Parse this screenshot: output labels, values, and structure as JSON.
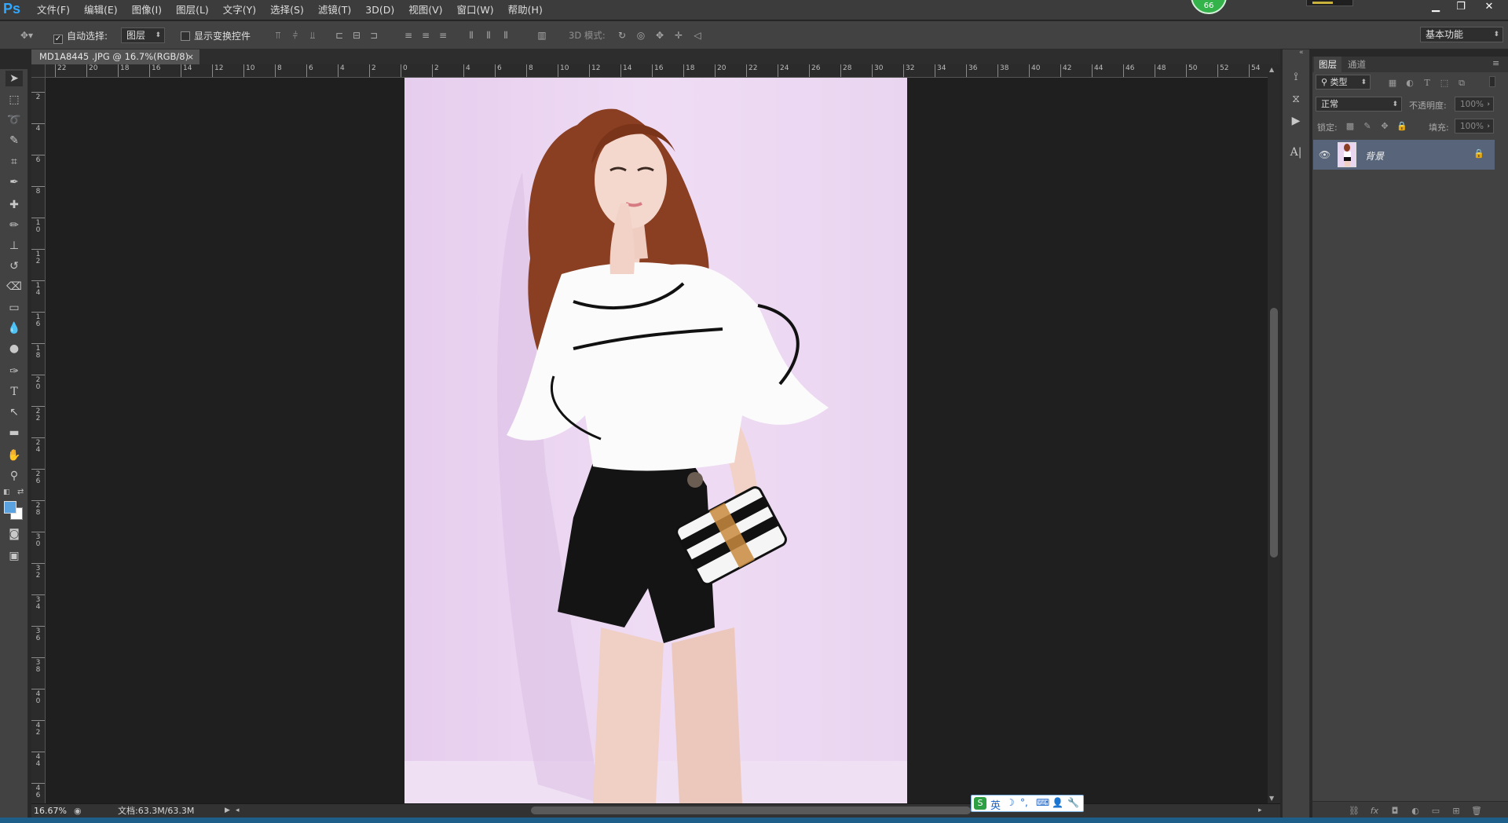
{
  "app": {
    "logo": "Ps",
    "notification_count": "66"
  },
  "menu": [
    "文件(F)",
    "编辑(E)",
    "图像(I)",
    "图层(L)",
    "文字(Y)",
    "选择(S)",
    "滤镜(T)",
    "3D(D)",
    "视图(V)",
    "窗口(W)",
    "帮助(H)"
  ],
  "window_controls": {
    "minimize": "▁",
    "restore": "❐",
    "close": "✕"
  },
  "options": {
    "auto_select_label": "自动选择:",
    "auto_select_checked": true,
    "auto_select_target": "图层",
    "show_transform_label": "显示变换控件",
    "show_transform_checked": false,
    "mode_3d_label": "3D 模式:",
    "workspace": "基本功能"
  },
  "document": {
    "tab_title": "MD1A8445 .JPG @ 16.7%(RGB/8)",
    "zoom": "16.67%",
    "doc_size": "文档:63.3M/63.3M"
  },
  "rulers": {
    "horizontal": [
      "22",
      "20",
      "18",
      "16",
      "14",
      "12",
      "10",
      "8",
      "6",
      "4",
      "2",
      "0",
      "2",
      "4",
      "6",
      "8",
      "10",
      "12",
      "14",
      "16",
      "18",
      "20",
      "22",
      "24",
      "26",
      "28",
      "30",
      "32",
      "34",
      "36",
      "38",
      "40",
      "42",
      "44",
      "46",
      "48",
      "50",
      "52",
      "54"
    ],
    "vertical": [
      "2",
      "4",
      "6",
      "8",
      "10",
      "12",
      "14",
      "16",
      "18",
      "20",
      "22",
      "24",
      "26",
      "28",
      "30",
      "32",
      "34",
      "36",
      "38",
      "40",
      "42",
      "44",
      "46"
    ]
  },
  "layers_panel": {
    "tabs": [
      "图层",
      "通道"
    ],
    "filter_kind": "类型",
    "blend_mode": "正常",
    "opacity_label": "不透明度:",
    "opacity_value": "100%",
    "lock_label": "锁定:",
    "fill_label": "填充:",
    "fill_value": "100%",
    "layers": [
      {
        "name": "背景",
        "visible": true,
        "locked": true
      }
    ]
  },
  "ime": {
    "mode": "英"
  },
  "colors": {
    "accent": "#31a8ff",
    "foreground": "#5aa2e0",
    "background": "#ffffff",
    "layer_selected": "#576479"
  }
}
